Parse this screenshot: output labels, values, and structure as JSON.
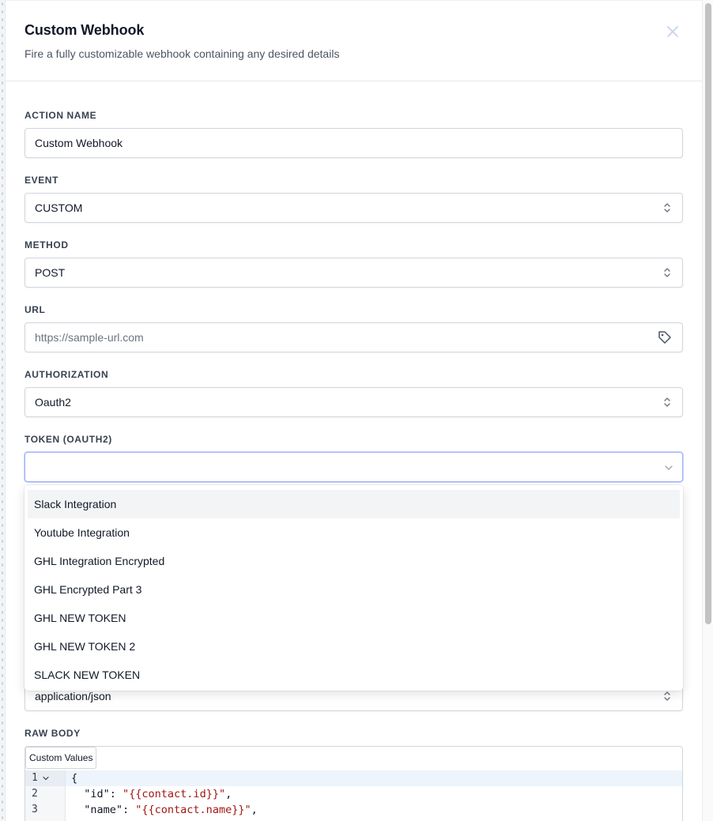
{
  "header": {
    "title": "Custom Webhook",
    "subtitle": "Fire a fully customizable webhook containing any desired details",
    "close_icon": "close-icon"
  },
  "form": {
    "action_name": {
      "label": "ACTION NAME",
      "value": "Custom Webhook"
    },
    "event": {
      "label": "EVENT",
      "value": "CUSTOM"
    },
    "method": {
      "label": "METHOD",
      "value": "POST"
    },
    "url": {
      "label": "URL",
      "placeholder": "https://sample-url.com",
      "icon": "tag-icon"
    },
    "authorization": {
      "label": "AUTHORIZATION",
      "value": "Oauth2"
    },
    "token": {
      "label": "TOKEN (OAUTH2)",
      "value": ""
    },
    "content_type": {
      "value": "application/json"
    },
    "raw_body": {
      "label": "RAW BODY",
      "custom_values_label": "Custom Values",
      "line_numbers": [
        "1",
        "2",
        "3"
      ],
      "lines": [
        {
          "text": "{"
        },
        {
          "key": "  \"id\": ",
          "str": "\"{{contact.id}}\"",
          "tail": ","
        },
        {
          "key": "  \"name\": ",
          "str": "\"{{contact.name}}\"",
          "tail": ","
        }
      ]
    }
  },
  "dropdown": {
    "options": [
      "Slack Integration",
      "Youtube Integration",
      "GHL Integration Encrypted",
      "GHL Encrypted Part 3",
      "GHL NEW TOKEN",
      "GHL NEW TOKEN 2",
      "SLACK NEW TOKEN"
    ],
    "highlighted": "Slack Integration"
  },
  "colors": {
    "focus_border": "#a5b4fc",
    "string_literal": "#a31515",
    "active_option_bg": "#f3f4f6"
  }
}
